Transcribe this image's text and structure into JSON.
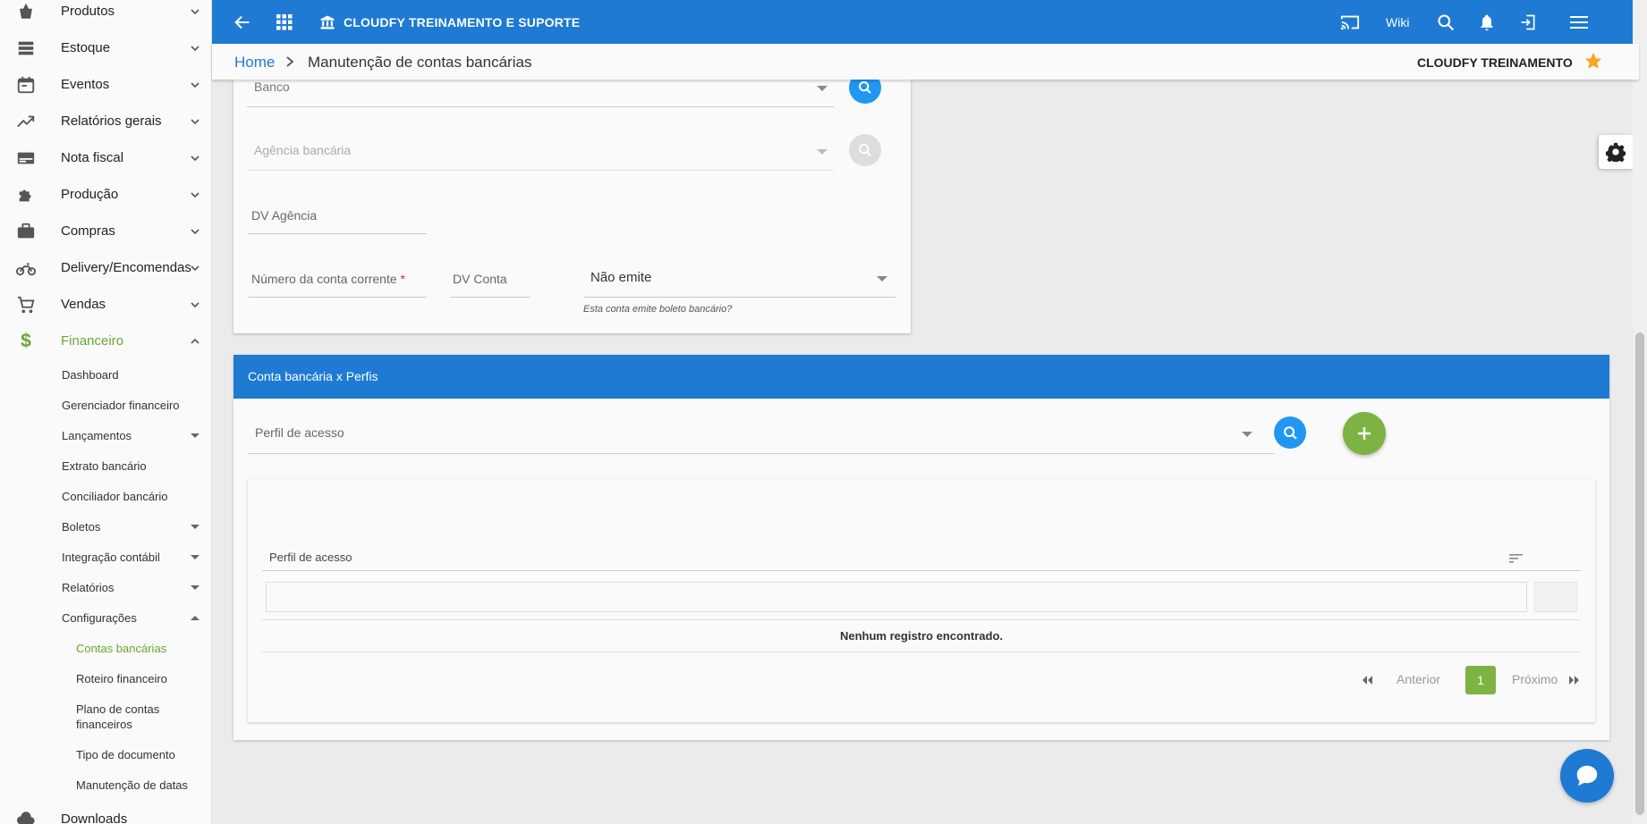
{
  "sidebar": {
    "nav": [
      {
        "label": "Produtos",
        "icon": "basket-icon"
      },
      {
        "label": "Estoque",
        "icon": "list-icon"
      },
      {
        "label": "Eventos",
        "icon": "calendar-icon"
      },
      {
        "label": "Relatórios gerais",
        "icon": "trending-up-icon"
      },
      {
        "label": "Nota fiscal",
        "icon": "card-icon"
      },
      {
        "label": "Produção",
        "icon": "puzzle-icon"
      },
      {
        "label": "Compras",
        "icon": "briefcase-icon"
      },
      {
        "label": "Delivery/Encomendas",
        "icon": "motorcycle-icon"
      },
      {
        "label": "Vendas",
        "icon": "cart-icon"
      },
      {
        "label": "Financeiro",
        "icon": "dollar-icon"
      }
    ],
    "financeiro_sub": {
      "dashboard": "Dashboard",
      "gerenciador": "Gerenciador financeiro",
      "lancamentos": "Lançamentos",
      "extrato": "Extrato bancário",
      "conciliador": "Conciliador bancário",
      "boletos": "Boletos",
      "integracao": "Integração contábil",
      "relatorios": "Relatórios",
      "configuracoes": "Configurações",
      "contas": "Contas bancárias",
      "roteiro": "Roteiro financeiro",
      "plano": "Plano de contas financeiros",
      "tipo": "Tipo de documento",
      "manutencao": "Manutenção de datas"
    },
    "downloads": "Downloads",
    "active_color": "#6aa533"
  },
  "topbar": {
    "title": "CLOUDFY TREINAMENTO E SUPORTE",
    "wiki": "Wiki",
    "color": "#1e7ad3"
  },
  "breadcrumb": {
    "home": "Home",
    "current": "Manutenção de contas bancárias",
    "user": "CLOUDFY TREINAMENTO"
  },
  "form": {
    "banco": "Banco",
    "agencia": "Agência bancária",
    "dv_agencia": "DV Agência",
    "numero_conta": "Número da conta corrente",
    "required_mark": "*",
    "dv_conta": "DV Conta",
    "boleto_value": "Não emite",
    "boleto_hint": "Esta conta emite boleto bancário?"
  },
  "perfis": {
    "title": "Conta bancária x Perfis",
    "select_placeholder": "Perfil de acesso",
    "column": "Perfil de acesso",
    "empty": "Nenhum registro encontrado.",
    "prev": "Anterior",
    "next": "Próximo",
    "page": "1",
    "accent": "#7cb342"
  }
}
